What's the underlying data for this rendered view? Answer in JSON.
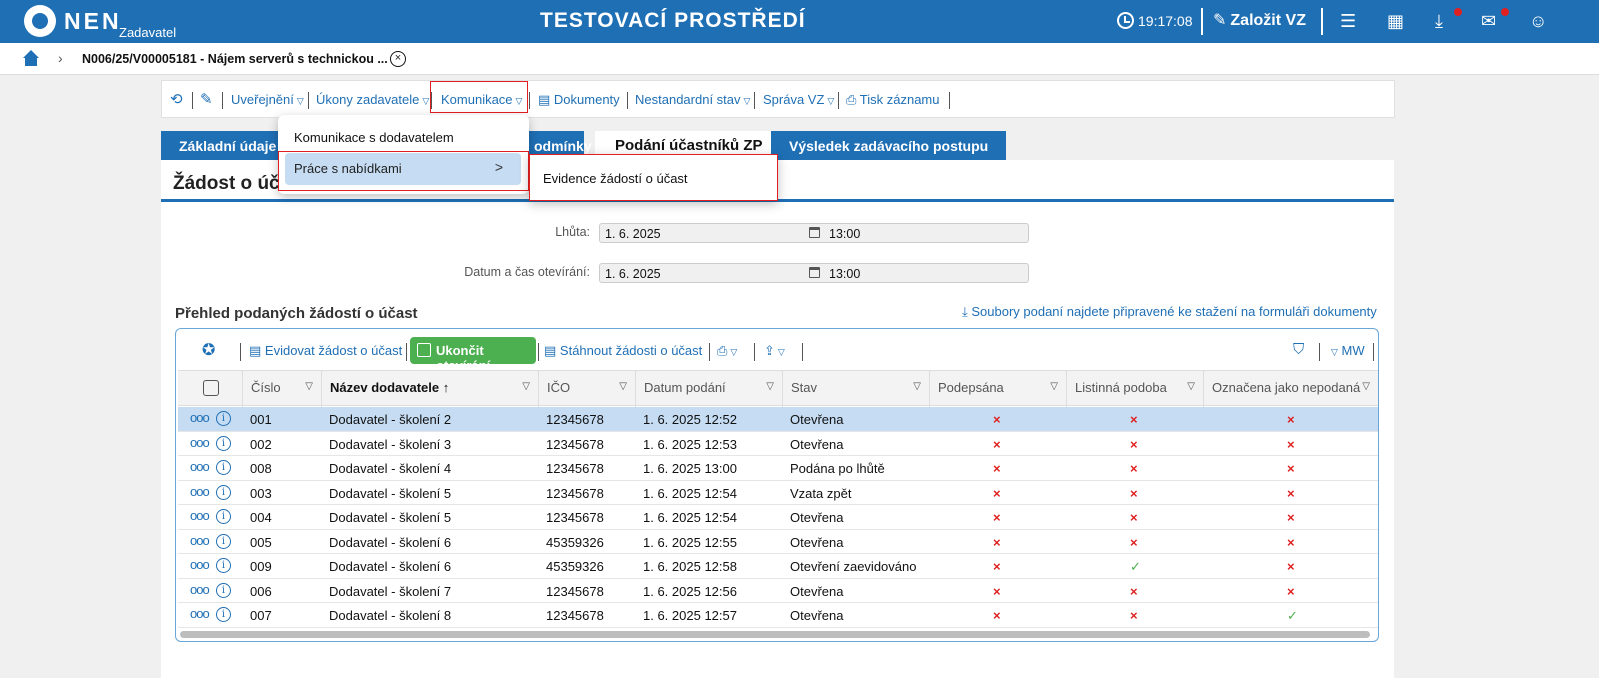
{
  "header": {
    "logo_text": "NEN",
    "logo_sub": "Zadavatel",
    "env_title": "TESTOVACÍ PROSTŘEDÍ",
    "clock": "19:17:08",
    "create_label": "Založit VZ"
  },
  "breadcrumb": {
    "title": "N006/25/V00005181 - Nájem serverů s technickou ..."
  },
  "toolbar": {
    "publish": "Uveřejnění",
    "acts": "Úkony zadavatele",
    "communication": "Komunikace",
    "documents": "Dokumenty",
    "nonstandard": "Nestandardní stav",
    "management": "Správa VZ",
    "print": "Tisk záznamu"
  },
  "menu": {
    "item1": "Komunikace s dodavatelem",
    "item2": "Práce s nabídkami",
    "item2_chevron": ">",
    "submenu_item": "Evidence žádostí o účast"
  },
  "tabs": {
    "basic": "Základní údaje",
    "conditions": "odmínky",
    "submissions": "Podání účastníků ZP",
    "result": "Výsledek zadávacího postupu"
  },
  "panel": {
    "title": "Žádost o účas"
  },
  "fields": {
    "deadline_label": "Lhůta:",
    "deadline_date": "1. 6. 2025",
    "deadline_time": "13:00",
    "opening_label": "Datum a čas otevírání:",
    "opening_date": "1. 6. 2025",
    "opening_time": "13:00"
  },
  "section": {
    "title": "Přehled podaných žádostí o účast",
    "download_link": "Soubory podaní najdete připravené ke stažení na formuláři dokumenty"
  },
  "grid_toolbar": {
    "register": "Evidovat žádost o účast",
    "finish_opening": "Ukončit otevírání",
    "download": "Stáhnout žádosti o účast",
    "mw": "MW"
  },
  "columns": {
    "number": "Číslo",
    "supplier": "Název dodavatele",
    "ico": "IČO",
    "date": "Datum podání",
    "state": "Stav",
    "signed": "Podepsána",
    "paper": "Listinná podoba",
    "not_submitted": "Označena jako nepodaná"
  },
  "rows": [
    {
      "num": "001",
      "supplier": "Dodavatel - školení 2",
      "ico": "12345678",
      "date": "1. 6. 2025 12:52",
      "state": "Otevřena",
      "signed": "×",
      "paper": "×",
      "nd": "×"
    },
    {
      "num": "002",
      "supplier": "Dodavatel - školení 3",
      "ico": "12345678",
      "date": "1. 6. 2025 12:53",
      "state": "Otevřena",
      "signed": "×",
      "paper": "×",
      "nd": "×"
    },
    {
      "num": "008",
      "supplier": "Dodavatel - školení 4",
      "ico": "12345678",
      "date": "1. 6. 2025 13:00",
      "state": "Podána po lhůtě",
      "signed": "×",
      "paper": "×",
      "nd": "×"
    },
    {
      "num": "003",
      "supplier": "Dodavatel - školení 5",
      "ico": "12345678",
      "date": "1. 6. 2025 12:54",
      "state": "Vzata zpět",
      "signed": "×",
      "paper": "×",
      "nd": "×"
    },
    {
      "num": "004",
      "supplier": "Dodavatel - školení 5",
      "ico": "12345678",
      "date": "1. 6. 2025 12:54",
      "state": "Otevřena",
      "signed": "×",
      "paper": "×",
      "nd": "×"
    },
    {
      "num": "005",
      "supplier": "Dodavatel - školení 6",
      "ico": "45359326",
      "date": "1. 6. 2025 12:55",
      "state": "Otevřena",
      "signed": "×",
      "paper": "×",
      "nd": "×"
    },
    {
      "num": "009",
      "supplier": "Dodavatel - školení 6",
      "ico": "45359326",
      "date": "1. 6. 2025 12:58",
      "state": "Otevření zaevidováno",
      "signed": "×",
      "paper": "✓",
      "nd": "×"
    },
    {
      "num": "006",
      "supplier": "Dodavatel - školení 7",
      "ico": "12345678",
      "date": "1. 6. 2025 12:56",
      "state": "Otevřena",
      "signed": "×",
      "paper": "×",
      "nd": "×"
    },
    {
      "num": "007",
      "supplier": "Dodavatel - školení 8",
      "ico": "12345678",
      "date": "1. 6. 2025 12:57",
      "state": "Otevřena",
      "signed": "×",
      "paper": "×",
      "nd": "✓"
    }
  ]
}
